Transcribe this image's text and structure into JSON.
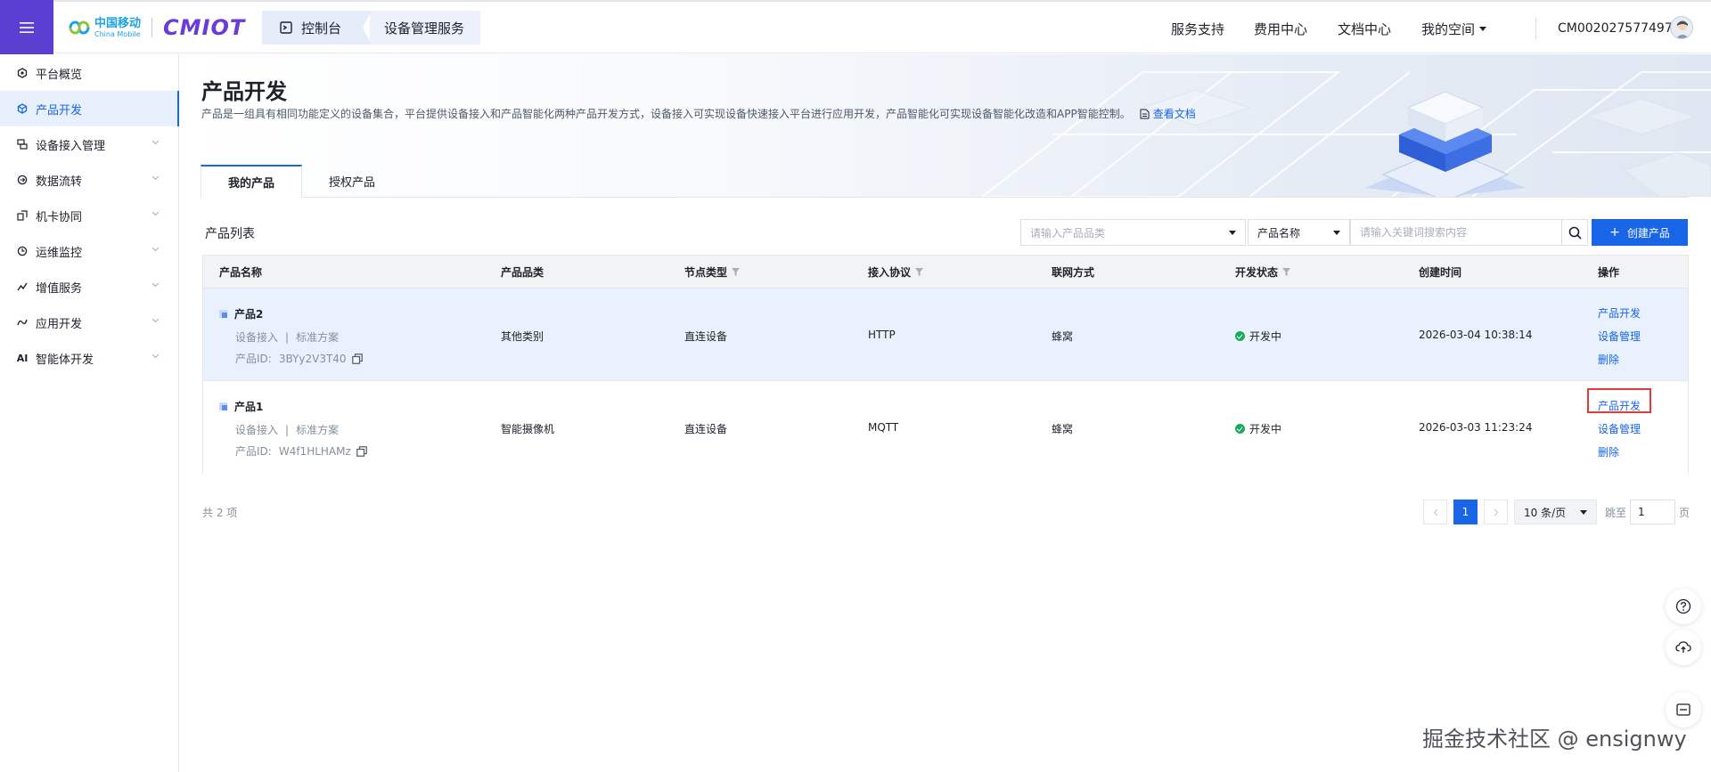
{
  "header": {
    "logo_cn": "中国移动",
    "logo_en": "China Mobile",
    "logo_product": "CMIOT",
    "breadcrumb": [
      "控制台",
      "设备管理服务"
    ],
    "nav": [
      "服务支持",
      "费用中心",
      "文档中心",
      "我的空间"
    ],
    "username": "CM002027577497"
  },
  "sidebar": {
    "items": [
      {
        "label": "平台概览",
        "icon": "overview-icon",
        "active": false,
        "expandable": false
      },
      {
        "label": "产品开发",
        "icon": "product-icon",
        "active": true,
        "expandable": false
      },
      {
        "label": "设备接入管理",
        "icon": "device-access-icon",
        "active": false,
        "expandable": true
      },
      {
        "label": "数据流转",
        "icon": "data-flow-icon",
        "active": false,
        "expandable": true
      },
      {
        "label": "机卡协同",
        "icon": "card-sync-icon",
        "active": false,
        "expandable": true
      },
      {
        "label": "运维监控",
        "icon": "monitor-icon",
        "active": false,
        "expandable": true
      },
      {
        "label": "增值服务",
        "icon": "value-added-icon",
        "active": false,
        "expandable": true
      },
      {
        "label": "应用开发",
        "icon": "app-dev-icon",
        "active": false,
        "expandable": true
      },
      {
        "label": "智能体开发",
        "icon": "ai-icon",
        "active": false,
        "expandable": true
      }
    ]
  },
  "page": {
    "title": "产品开发",
    "description": "产品是一组具有相同功能定义的设备集合，平台提供设备接入和产品智能化两种产品开发方式，设备接入可实现设备快速接入平台进行应用开发，产品智能化可实现设备智能化改造和APP智能控制。",
    "doc_link": "查看文档",
    "tabs": [
      "我的产品",
      "授权产品"
    ]
  },
  "toolbar": {
    "section_title": "产品列表",
    "category_placeholder": "请输入产品品类",
    "field_select": "产品名称",
    "keyword_placeholder": "请输入关键词搜索内容",
    "create_label": "创建产品"
  },
  "table": {
    "headers": [
      "产品名称",
      "产品品类",
      "节点类型",
      "接入协议",
      "联网方式",
      "开发状态",
      "创建时间",
      "操作"
    ],
    "rows": [
      {
        "name": "产品2",
        "access": "设备接入",
        "scheme": "标准方案",
        "id_label": "产品ID:",
        "id": "3BYy2V3T40",
        "category": "其他类别",
        "node_type": "直连设备",
        "protocol": "HTTP",
        "network": "蜂窝",
        "status": "开发中",
        "created": "2026-03-04 10:38:14",
        "ops": [
          "产品开发",
          "设备管理",
          "删除"
        ]
      },
      {
        "name": "产品1",
        "access": "设备接入",
        "scheme": "标准方案",
        "id_label": "产品ID:",
        "id": "W4f1HLHAMz",
        "category": "智能摄像机",
        "node_type": "直连设备",
        "protocol": "MQTT",
        "network": "蜂窝",
        "status": "开发中",
        "created": "2026-03-03 11:23:24",
        "ops": [
          "产品开发",
          "设备管理",
          "删除"
        ]
      }
    ]
  },
  "pager": {
    "total": "共 2 项",
    "current_page": "1",
    "page_size": "10 条/页",
    "jump_label": "跳至",
    "jump_value": "1",
    "page_unit": "页"
  },
  "colors": {
    "primary": "#1865e8",
    "menu_bg": "#5b3fd3",
    "status_green": "#1aab5c",
    "highlight_red": "#e33b3b"
  },
  "watermark": "掘金技术社区 @ ensignwy"
}
